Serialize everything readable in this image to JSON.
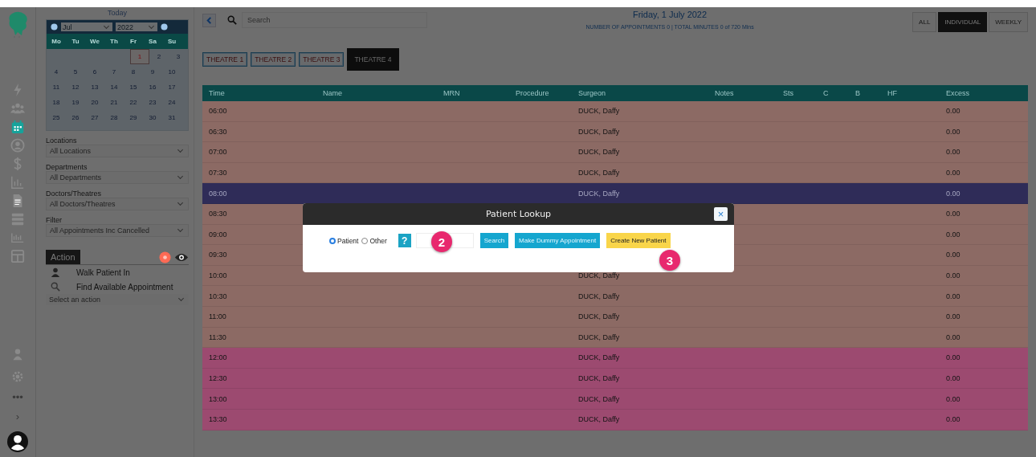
{
  "rail": {
    "items": [
      {
        "kind": "bolt",
        "selected": false
      },
      {
        "kind": "people",
        "selected": false
      },
      {
        "kind": "calendar",
        "selected": true
      },
      {
        "kind": "user-circle",
        "selected": false
      },
      {
        "kind": "dollar",
        "selected": false
      },
      {
        "kind": "chart",
        "selected": false
      },
      {
        "kind": "document",
        "selected": false
      },
      {
        "kind": "list",
        "selected": false
      },
      {
        "kind": "numbers",
        "selected": false
      },
      {
        "kind": "grid",
        "selected": false
      }
    ],
    "bottom": [
      {
        "kind": "person"
      },
      {
        "kind": "gear"
      },
      {
        "kind": "text",
        "text": "•••"
      },
      {
        "kind": "text",
        "text": "›"
      },
      {
        "kind": "avatar"
      }
    ]
  },
  "panel": {
    "today": "Today",
    "calendar": {
      "month": "Jul",
      "year": "2022",
      "weekdays": [
        "Mo",
        "Tu",
        "We",
        "Th",
        "Fr",
        "Sa",
        "Su"
      ],
      "weeks": [
        [
          {
            "label": "1",
            "selected": true
          },
          {
            "label": "2",
            "selected": false
          },
          {
            "label": "3",
            "selected": false
          }
        ],
        [
          {
            "label": "4",
            "selected": false
          },
          {
            "label": "5",
            "selected": false
          },
          {
            "label": "6",
            "selected": false
          },
          {
            "label": "7",
            "selected": false
          },
          {
            "label": "8",
            "selected": false
          },
          {
            "label": "9",
            "selected": false
          },
          {
            "label": "10",
            "selected": false
          }
        ],
        [
          {
            "label": "11",
            "selected": false
          },
          {
            "label": "12",
            "selected": false
          },
          {
            "label": "13",
            "selected": false
          },
          {
            "label": "14",
            "selected": false
          },
          {
            "label": "15",
            "selected": false
          },
          {
            "label": "16",
            "selected": false
          },
          {
            "label": "17",
            "selected": false
          }
        ],
        [
          {
            "label": "18",
            "selected": false
          },
          {
            "label": "19",
            "selected": false
          },
          {
            "label": "20",
            "selected": false
          },
          {
            "label": "21",
            "selected": false
          },
          {
            "label": "22",
            "selected": false
          },
          {
            "label": "23",
            "selected": false
          },
          {
            "label": "24",
            "selected": false
          }
        ],
        [
          {
            "label": "25",
            "selected": false
          },
          {
            "label": "26",
            "selected": false
          },
          {
            "label": "27",
            "selected": false
          },
          {
            "label": "28",
            "selected": false
          },
          {
            "label": "29",
            "selected": false
          },
          {
            "label": "30",
            "selected": false
          },
          {
            "label": "31",
            "selected": false
          }
        ]
      ]
    },
    "filters": [
      {
        "label": "Locations",
        "value": "All Locations"
      },
      {
        "label": "Departments",
        "value": "All Departments"
      },
      {
        "label": "Doctors/Theatres",
        "value": "All Doctors/Theatres"
      },
      {
        "label": "Filter",
        "value": "All Appointments Inc Cancelled"
      }
    ],
    "action": {
      "tab": "Action",
      "items": [
        {
          "kind": "walk",
          "label": "Walk Patient In"
        },
        {
          "kind": "find",
          "label": "Find Available Appointment"
        }
      ],
      "select": "Select an action"
    }
  },
  "top": {
    "search_placeholder": "Search",
    "date": "Friday, 1 July 2022",
    "summary": "NUMBER OF APPOINTMENTS 0  |  TOTAL MINUTES 0 of 720 Mins",
    "views": [
      {
        "label": "ALL",
        "selected": false
      },
      {
        "label": "INDIVIDUAL",
        "selected": true
      },
      {
        "label": "WEEKLY",
        "selected": false
      }
    ],
    "theatres": [
      {
        "label": "THEATRE 1",
        "selected": false
      },
      {
        "label": "THEATRE 2",
        "selected": false
      },
      {
        "label": "THEATRE 3",
        "selected": false
      },
      {
        "label": "THEATRE 4",
        "selected": true
      }
    ]
  },
  "table": {
    "columns": [
      "Time",
      "Name",
      "MRN",
      "Procedure",
      "Surgeon",
      "Notes",
      "Sts",
      "C",
      "B",
      "HF",
      "Excess"
    ],
    "rows": [
      {
        "time": "06:00",
        "surgeon": "DUCK, Daffy",
        "excess": "0.00",
        "color": "#8c6a64",
        "selected": false
      },
      {
        "time": "06:30",
        "surgeon": "DUCK, Daffy",
        "excess": "0.00",
        "color": "#8c6a64",
        "selected": false
      },
      {
        "time": "07:00",
        "surgeon": "DUCK, Daffy",
        "excess": "0.00",
        "color": "#8c6a64",
        "selected": false
      },
      {
        "time": "07:30",
        "surgeon": "DUCK, Daffy",
        "excess": "0.00",
        "color": "#8c6a64",
        "selected": false
      },
      {
        "time": "08:00",
        "surgeon": "DUCK, Daffy",
        "excess": "0.00",
        "selected": true
      },
      {
        "time": "08:30",
        "excess": "0.00",
        "color": "#8c6a64",
        "selected": false
      },
      {
        "time": "09:00",
        "excess": "0.00",
        "color": "#8c6a64",
        "selected": false
      },
      {
        "time": "09:30",
        "excess": "0.00",
        "color": "#8c6a64",
        "selected": false
      },
      {
        "time": "10:00",
        "surgeon": "DUCK, Daffy",
        "excess": "0.00",
        "color": "#8c6a64",
        "selected": false
      },
      {
        "time": "10:30",
        "surgeon": "DUCK, Daffy",
        "excess": "0.00",
        "color": "#8c6a64",
        "selected": false
      },
      {
        "time": "11:00",
        "surgeon": "DUCK, Daffy",
        "excess": "0.00",
        "color": "#8c6a64",
        "selected": false
      },
      {
        "time": "11:30",
        "surgeon": "DUCK, Daffy",
        "excess": "0.00",
        "color": "#8c6a64",
        "selected": false
      },
      {
        "time": "12:00",
        "surgeon": "DUCK, Daffy",
        "excess": "0.00",
        "color": "#9c4a70",
        "selected": false
      },
      {
        "time": "12:30",
        "surgeon": "DUCK, Daffy",
        "excess": "0.00",
        "color": "#9c4a70",
        "selected": false
      },
      {
        "time": "13:00",
        "surgeon": "DUCK, Daffy",
        "excess": "0.00",
        "color": "#9c4a70",
        "selected": false
      },
      {
        "time": "13:30",
        "surgeon": "DUCK, Daffy",
        "excess": "0.00",
        "color": "#9c4a70",
        "selected": false
      }
    ]
  },
  "modal": {
    "title": "Patient Lookup",
    "close": "×",
    "radios": [
      {
        "label": "Patient",
        "selected": true
      },
      {
        "label": "Other",
        "selected": false
      }
    ],
    "help": "?",
    "buttons": [
      {
        "kind": "primary",
        "label": "Search"
      },
      {
        "kind": "primary",
        "label": "Make Dummy Appointment"
      },
      {
        "kind": "warning",
        "label": "Create New Patient"
      }
    ],
    "markers": [
      "2",
      "3"
    ]
  }
}
